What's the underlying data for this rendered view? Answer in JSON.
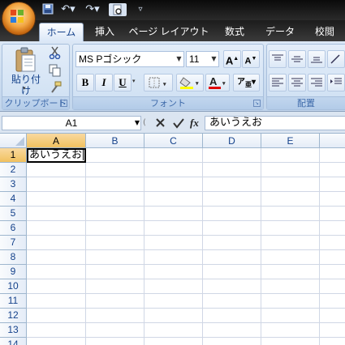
{
  "title_bar": {
    "quick_access": [
      "save-icon",
      "undo-icon",
      "redo-icon",
      "print-preview-icon",
      "customize-dropdown-icon"
    ]
  },
  "tabs": [
    {
      "label": "ホーム",
      "active": true
    },
    {
      "label": "挿入"
    },
    {
      "label": "ページ レイアウト"
    },
    {
      "label": "数式"
    },
    {
      "label": "データ"
    },
    {
      "label": "校閲"
    }
  ],
  "ribbon": {
    "clipboard": {
      "paste_label": "貼り付け",
      "group_label": "クリップボード"
    },
    "font": {
      "font_name": "MS Pゴシック",
      "font_size": "11",
      "bold": "B",
      "italic": "I",
      "underline": "U",
      "group_label": "フォント"
    },
    "alignment": {
      "group_label": "配置"
    }
  },
  "formula_bar": {
    "name_box": "A1",
    "function_label": "fx",
    "content": "あいうえお"
  },
  "sheet": {
    "columns": [
      "A",
      "B",
      "C",
      "D",
      "E"
    ],
    "rows": [
      "1",
      "2",
      "3",
      "4",
      "5",
      "6",
      "7",
      "8",
      "9",
      "10",
      "11",
      "12",
      "13",
      "14"
    ],
    "active_cell": "A1",
    "cells": {
      "A1": "あいうえお"
    }
  },
  "colors": {
    "accent": "#15428b",
    "ribbon_bg": "#dbe7f5",
    "selection": "#f1c15f",
    "font_color_bar": "#e00000",
    "highlight_bar": "#ffff00"
  }
}
